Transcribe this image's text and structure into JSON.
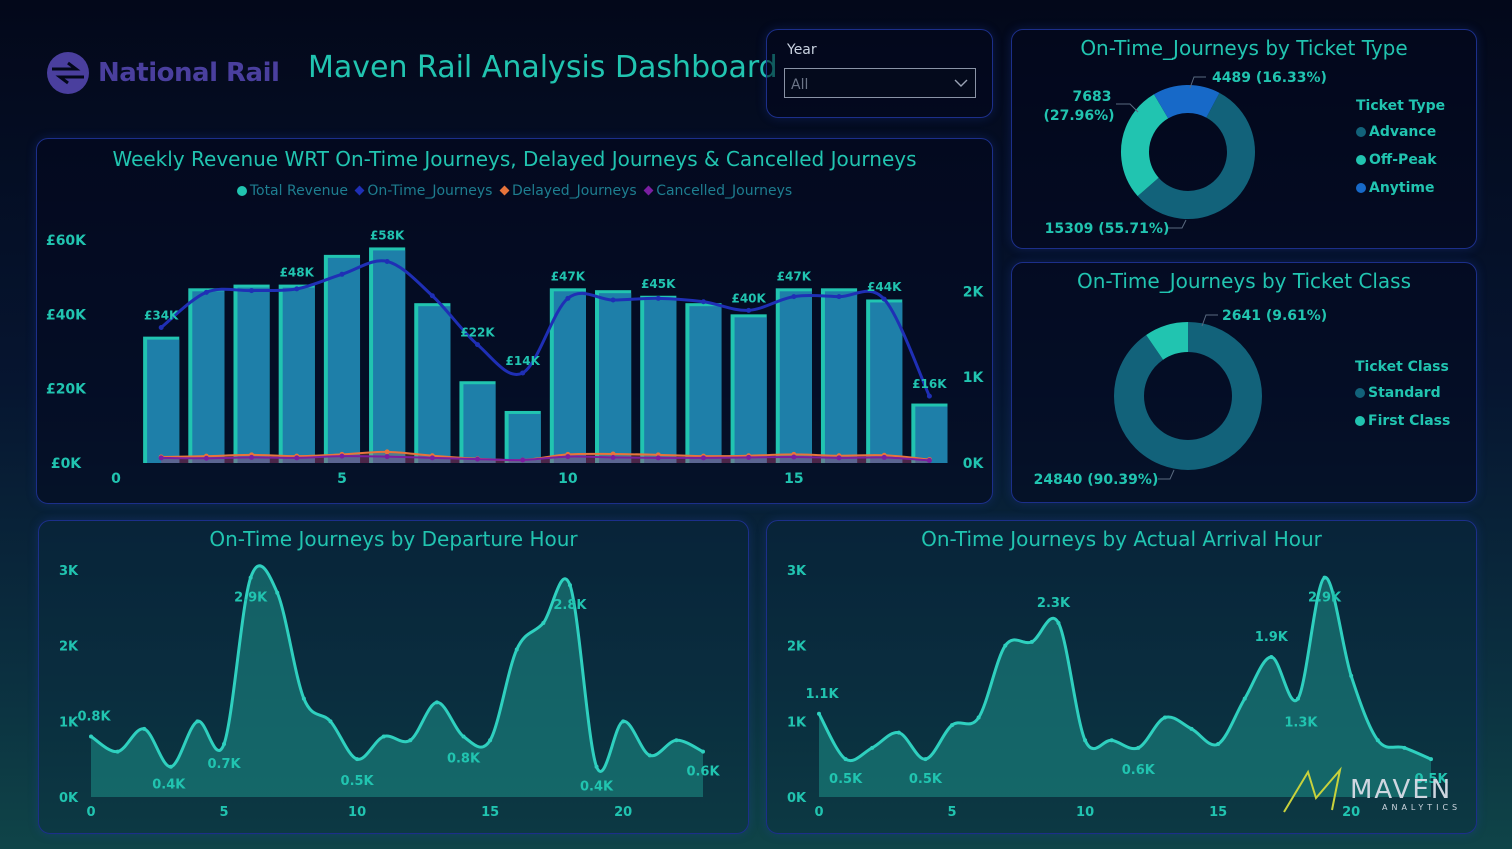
{
  "header": {
    "brand": "National Rail",
    "title": "Maven Rail Analysis Dashboard"
  },
  "filter": {
    "label": "Year",
    "value": "All"
  },
  "weekly": {
    "title": "Weekly Revenue WRT On-Time Journeys, Delayed Journeys & Cancelled Journeys",
    "legend": [
      "Total Revenue",
      "On-Time_Journeys",
      "Delayed_Journeys",
      "Cancelled_Journeys"
    ],
    "colors": {
      "revenue": "#21c4b0",
      "ontime": "#1f2fb5",
      "delayed": "#e8743b",
      "cancelled": "#7a1ea1",
      "bar_overlay": "#1e78a8"
    }
  },
  "ticket_type": {
    "title": "On-Time_Journeys by Ticket Type",
    "legend_title": "Ticket Type",
    "labels": [
      "15309 (55.71%)",
      "7683\n(27.96%)",
      "4489 (16.33%)"
    ]
  },
  "ticket_class": {
    "title": "On-Time_Journeys by Ticket Class",
    "legend_title": "Ticket Class",
    "labels": [
      "24840 (90.39%)",
      "2641 (9.61%)"
    ]
  },
  "departure": {
    "title": "On-Time Journeys by Departure Hour"
  },
  "arrival": {
    "title": "On-Time Journeys by Actual Arrival Hour"
  },
  "watermark": {
    "name": "MAVEN",
    "sub": "ANALYTICS"
  },
  "chart_data": [
    {
      "type": "bar",
      "id": "weekly",
      "title": "Weekly Revenue WRT On-Time Journeys, Delayed Journeys & Cancelled Journeys",
      "categories": [
        1,
        2,
        3,
        4,
        5,
        6,
        7,
        8,
        9,
        10,
        11,
        12,
        13,
        14,
        15,
        16,
        17,
        18
      ],
      "x_ticks": [
        0,
        5,
        10,
        15
      ],
      "series": [
        {
          "name": "Total Revenue",
          "axis": "left",
          "values": [
            34000,
            47000,
            48000,
            48000,
            56000,
            58000,
            43000,
            22000,
            14000,
            47000,
            46500,
            45000,
            43000,
            40000,
            47000,
            47000,
            44000,
            16000
          ]
        },
        {
          "name": "On-Time_Journeys",
          "axis": "right",
          "values": [
            1580,
            1990,
            2010,
            2030,
            2200,
            2350,
            1950,
            1380,
            1050,
            1920,
            1900,
            1920,
            1880,
            1780,
            1940,
            1940,
            1910,
            780
          ]
        },
        {
          "name": "Delayed_Journeys",
          "axis": "right",
          "values": [
            70,
            80,
            95,
            80,
            100,
            130,
            85,
            50,
            35,
            100,
            105,
            95,
            80,
            85,
            100,
            85,
            90,
            40
          ]
        },
        {
          "name": "Cancelled_Journeys",
          "axis": "right",
          "values": [
            60,
            55,
            65,
            60,
            80,
            75,
            60,
            45,
            35,
            75,
            65,
            60,
            60,
            65,
            70,
            60,
            65,
            30
          ]
        }
      ],
      "data_labels": {
        "1": "£34K",
        "4": "£48K",
        "6": "£58K",
        "8": "£22K",
        "9": "£14K",
        "10": "£47K",
        "12": "£45K",
        "14": "£40K",
        "15": "£47K",
        "17": "£44K",
        "18": "£16K"
      },
      "y_left": {
        "ticks": [
          0,
          20000,
          40000,
          60000
        ],
        "labels": [
          "£0K",
          "£20K",
          "£40K",
          "£60K"
        ],
        "ylim": [
          0,
          60000
        ]
      },
      "y_right": {
        "ticks": [
          0,
          1000,
          2000
        ],
        "labels": [
          "0K",
          "1K",
          "2K"
        ],
        "ylim": [
          0,
          2600
        ]
      }
    },
    {
      "type": "pie",
      "id": "ticket_type",
      "title": "On-Time_Journeys by Ticket Type",
      "labels": [
        "Advance",
        "Off-Peak",
        "Anytime"
      ],
      "values": [
        15309,
        7683,
        4489
      ],
      "percent": [
        55.71,
        27.96,
        16.33
      ],
      "colors": [
        "#12627a",
        "#21c4b0",
        "#1769c8"
      ]
    },
    {
      "type": "pie",
      "id": "ticket_class",
      "title": "On-Time_Journeys by Ticket Class",
      "labels": [
        "Standard",
        "First Class"
      ],
      "values": [
        24840,
        2641
      ],
      "percent": [
        90.39,
        9.61
      ],
      "colors": [
        "#12627a",
        "#21c4b0"
      ]
    },
    {
      "type": "area",
      "id": "departure",
      "title": "On-Time Journeys by Departure Hour",
      "x": [
        0,
        1,
        2,
        3,
        4,
        5,
        6,
        7,
        8,
        9,
        10,
        11,
        12,
        13,
        14,
        15,
        16,
        17,
        18,
        19,
        20,
        21,
        22,
        23
      ],
      "y": [
        800,
        600,
        900,
        400,
        1000,
        700,
        2900,
        2700,
        1300,
        1000,
        500,
        800,
        750,
        1250,
        800,
        750,
        1950,
        2300,
        2800,
        400,
        1000,
        550,
        750,
        600
      ],
      "x_ticks": [
        0,
        5,
        10,
        15,
        20
      ],
      "y_ticks": [
        0,
        1000,
        2000,
        3000
      ],
      "y_labels": [
        "0K",
        "1K",
        "2K",
        "3K"
      ],
      "ylim": [
        0,
        3000
      ],
      "data_labels": {
        "0": "0.8K",
        "3": "0.4K",
        "5": "0.7K",
        "6": "2.9K",
        "10": "0.5K",
        "14": "0.8K",
        "18": "2.8K",
        "19": "0.4K",
        "23": "0.6K"
      }
    },
    {
      "type": "area",
      "id": "arrival",
      "title": "On-Time Journeys by Actual Arrival Hour",
      "x": [
        0,
        1,
        2,
        3,
        4,
        5,
        6,
        7,
        8,
        9,
        10,
        11,
        12,
        13,
        14,
        15,
        16,
        17,
        18,
        19,
        20,
        21,
        22,
        23
      ],
      "y": [
        1100,
        500,
        650,
        850,
        500,
        950,
        1050,
        2000,
        2050,
        2300,
        750,
        750,
        650,
        1050,
        900,
        700,
        1300,
        1850,
        1300,
        2900,
        1600,
        750,
        650,
        500
      ],
      "x_ticks": [
        0,
        5,
        10,
        15,
        20
      ],
      "y_ticks": [
        0,
        1000,
        2000,
        3000
      ],
      "y_labels": [
        "0K",
        "1K",
        "2K",
        "3K"
      ],
      "ylim": [
        0,
        3000
      ],
      "data_labels": {
        "0": "1.1K",
        "1": "0.5K",
        "4": "0.5K",
        "9": "2.3K",
        "12": "0.6K",
        "17": "1.9K",
        "18": "1.3K",
        "19": "2.9K",
        "23": "0.5K"
      }
    }
  ]
}
